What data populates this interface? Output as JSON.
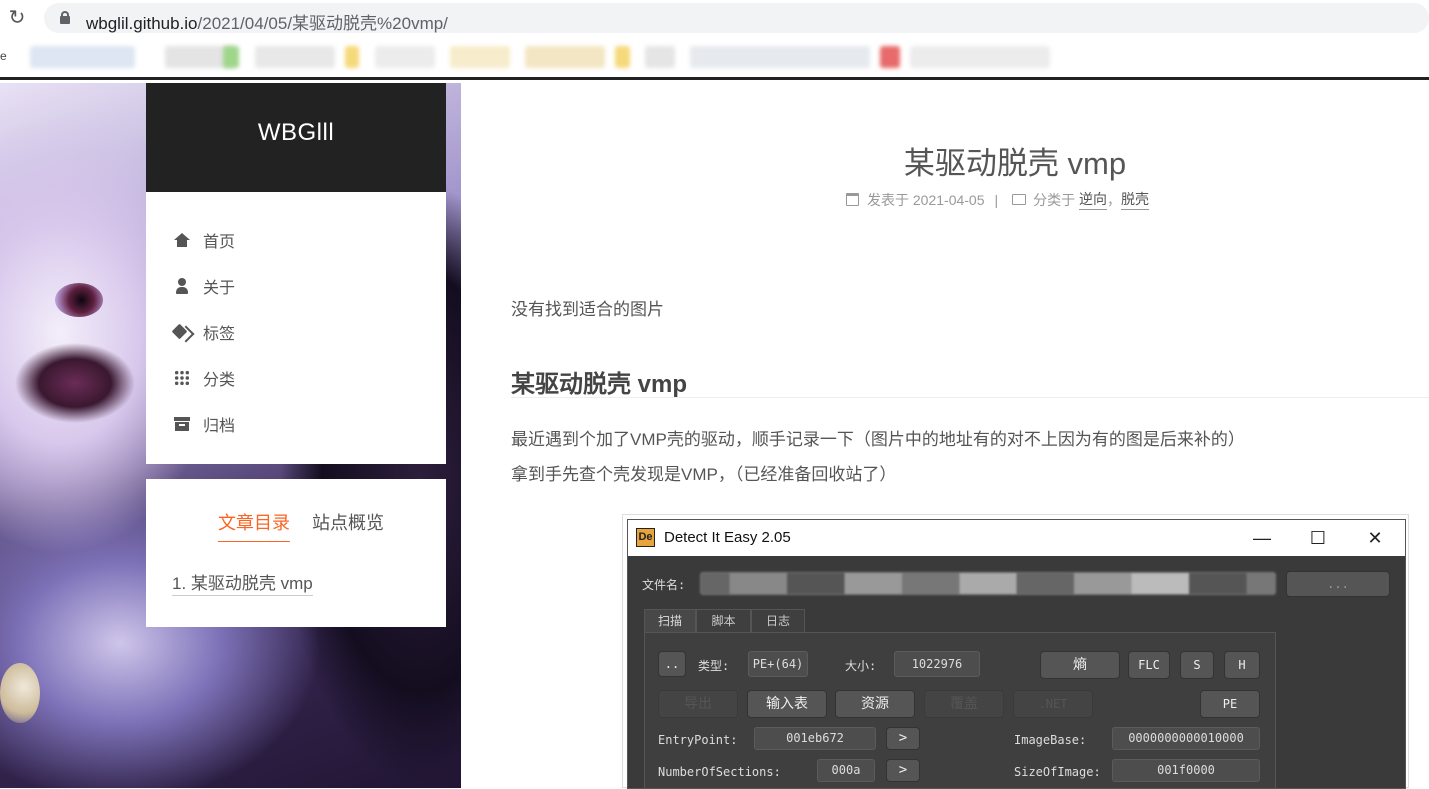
{
  "browser": {
    "url_host": "wbglil.github.io",
    "url_path": "/2021/04/05/某驱动脱壳%20vmp/",
    "bookmark_leading": "e"
  },
  "sidebar": {
    "brand": "WBGlll",
    "menu": [
      {
        "icon": "home-icon",
        "label": "首页"
      },
      {
        "icon": "user-icon",
        "label": "关于"
      },
      {
        "icon": "tags-icon",
        "label": "标签"
      },
      {
        "icon": "grid-icon",
        "label": "分类"
      },
      {
        "icon": "archive-icon",
        "label": "归档"
      }
    ],
    "toc_tabs": [
      "文章目录",
      "站点概览"
    ],
    "toc_items": [
      "1. 某驱动脱壳 vmp"
    ]
  },
  "post": {
    "title": "某驱动脱壳 vmp",
    "meta_posted_label": "发表于",
    "meta_date": "2021-04-05",
    "meta_sep": "|",
    "meta_category_label": "分类于",
    "categories": [
      "逆向",
      "脱壳"
    ],
    "category_comma": "，",
    "p_no_image": "没有找到适合的图片",
    "h2": "某驱动脱壳 vmp",
    "p_line1": "最近遇到个加了VMP壳的驱动，顺手记录一下（图片中的地址有的对不上因为有的图是后来补的）",
    "p_line2": "拿到手先查个壳发现是VMP，（已经准备回收站了）"
  },
  "die": {
    "title": "Detect It Easy 2.05",
    "logo": "De",
    "win_min": "—",
    "win_max": "☐",
    "win_close": "✕",
    "file_label": "文件名:",
    "browse_btn": "...",
    "tabs": [
      "扫描",
      "脚本",
      "日志"
    ],
    "dotdot_btn": "..",
    "type_label": "类型:",
    "type_value": "PE+(64)",
    "size_label": "大小:",
    "size_value": "1022976",
    "entropy_btn": "熵",
    "flc_btn": "FLC",
    "s_btn": "S",
    "h_btn": "H",
    "export_btn": "导出",
    "import_btn": "输入表",
    "resource_btn": "资源",
    "overlay_btn": "覆盖",
    "net_btn": ".NET",
    "pe_btn": "PE",
    "entry_label": "EntryPoint:",
    "entry_value": "001eb672",
    "entry_go": ">",
    "imagebase_label": "ImageBase:",
    "imagebase_value": "0000000000010000",
    "sections_label": "NumberOfSections:",
    "sections_value": "000a",
    "sections_go": ">",
    "sizeofimage_label": "SizeOfImage:",
    "sizeofimage_value": "001f0000"
  }
}
